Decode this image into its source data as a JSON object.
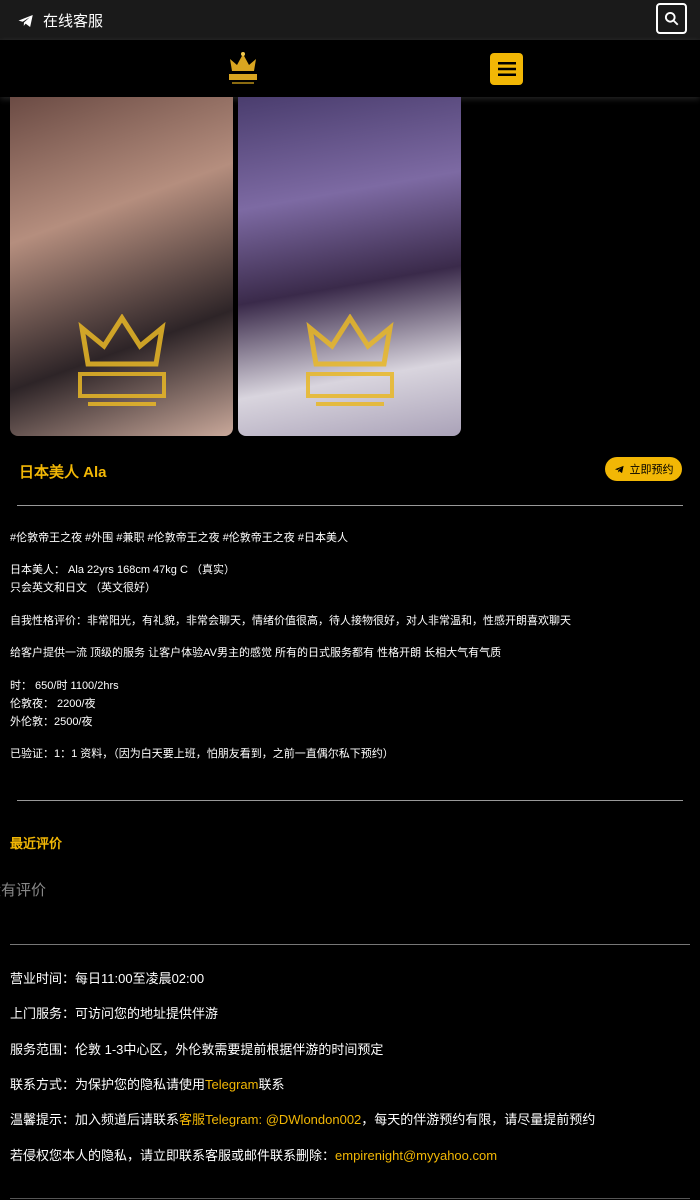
{
  "topbar": {
    "cs_label": "在线客服",
    "cs_icon": "telegram-icon",
    "search_icon": "search-icon"
  },
  "header": {
    "logo_icon": "crown-logo",
    "menu_icon": "hamburger-menu-icon"
  },
  "colors": {
    "accent": "#f2b705",
    "background": "#000000"
  },
  "profile": {
    "title": "日本美人 Ala",
    "book_label": "立即预约",
    "tags": "#伦敦帝王之夜 #外围 #兼职 #伦敦帝王之夜 #伦敦帝王之夜 #日本美人",
    "line1": "日本美人：  Ala 22yrs 168cm 47kg  C （真实）",
    "line2": "只会英文和日文 （英文很好）",
    "line3": "自我性格评价：非常阳光，有礼貌，非常会聊天，情绪价值很高，待人接物很好，对人非常温和，性感开朗喜欢聊天",
    "line4": "给客户提供一流 顶级的服务 让客户体验AV男主的感觉 所有的日式服务都有 性格开朗 长相大气有气质",
    "price1": "时：  650/时 1100/2hrs",
    "price2": "伦敦夜：  2200/夜",
    "price3": "外伦敦：2500/夜",
    "verify": "已验证：1：1 资料，（因为白天要上班，怕朋友看到，之前一直偶尔私下预约）"
  },
  "reviews": {
    "heading": "最近评价",
    "empty": "没有评价"
  },
  "info": {
    "hours": "营业时间：每日11:00至凌晨02:00",
    "service": "上门服务：可访问您的地址提供伴游",
    "area": "服务范围：伦敦 1-3中心区，外伦敦需要提前根据伴游的时间预定",
    "contact_pre": "联系方式：为保护您的隐私请使用",
    "contact_link": "Telegram",
    "contact_post": "联系",
    "tip_pre": "温馨提示：加入频道后请联系",
    "tip_link": "客服Telegram: @DWlondon002",
    "tip_post": "，每天的伴游预约有限，请尽量提前预约",
    "privacy_pre": "若侵权您本人的隐私，请立即联系客服或邮件联系删除：",
    "privacy_link": "empirenight@myyahoo.com"
  }
}
